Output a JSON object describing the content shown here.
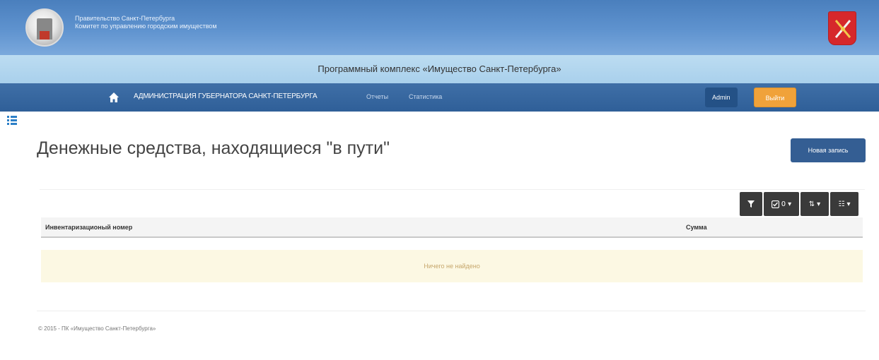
{
  "header": {
    "org_line1": "Правительство Санкт-Петербурга",
    "org_line2": "Комитет по управлению городским имуществом",
    "app_title": "Программный комплекс «Имущество Санкт-Петербурга»"
  },
  "navbar": {
    "brand": "АДМИНИСТРАЦИЯ ГУБЕРНАТОРА САНКТ-ПЕТЕРБУРГА",
    "links": [
      "Отчеты",
      "Статистика"
    ],
    "user": "Admin",
    "logout": "Выйти"
  },
  "page": {
    "title": "Денежные средства, находящиеся \"в пути\"",
    "new_record": "Новая запись"
  },
  "toolbar": {
    "check_count": "0"
  },
  "table": {
    "columns": [
      "Инвентаризационый номер",
      "Сумма"
    ],
    "empty_text": "Ничего не найдено"
  },
  "footer": {
    "text": "© 2015 - ПК «Имущество Санкт-Петербурга»"
  },
  "colors": {
    "header_blue": "#5f93cf",
    "navbar_blue": "#2f5f98",
    "logout_orange": "#f0a23a",
    "toolbar_dark": "#3a3a3a",
    "empty_row_bg": "#fcf8e3"
  },
  "icons": {
    "home": "home-icon",
    "sidebar": "list-icon",
    "filter": "filter-icon",
    "check": "check-icon",
    "sort": "sort-icon",
    "columns": "columns-icon"
  }
}
